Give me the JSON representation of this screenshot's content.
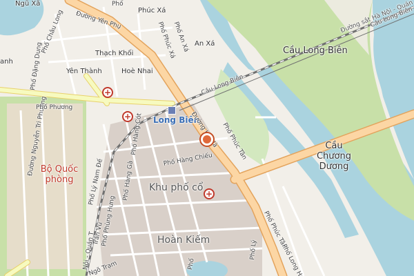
{
  "colors": {
    "land": "#f2efe9",
    "water": "#aad3df",
    "park": "#c8e0a8",
    "military": "#f0dcd5",
    "primary_road": "#fcd6a4",
    "secondary_road": "#f7fabf",
    "minor_road": "#ffffff",
    "railway": "#707070",
    "hospital": "#c0392b",
    "marker": "#e06a3b"
  },
  "icons": {
    "hospital": "hospital-cross-icon",
    "marker": "location-marker-icon",
    "station": "railway-station-icon"
  },
  "labels": {
    "ngu_xa": "Ngũ Xã",
    "duong_yen_phu": "Đường Yên Phụ",
    "phuc_xa": "Phúc Xá",
    "pho_chau_long": "Phố Châu Long",
    "thach_khoi": "Thạch Khối",
    "an_xa": "An Xá",
    "pho_an_xa": "Phố An Xá",
    "pho_phuc_xa": "Phố Phúc Xá",
    "yen_thanh": "Yên Thành",
    "hoe_nhai": "Hoè Nhai",
    "anh": "anh",
    "pho_dang_dung": "Phố Đặng Dung",
    "cau_long_bien_top": "Cầu Long Biên",
    "cau_long_bien_rail": "Cầu Long Biên",
    "rail_label": "Đường sắt Hà Nội - Quán Triều",
    "cau_long_bien_ne": "Cầu Long Biên",
    "long_bien_station": "Long Biên",
    "duong_nguyen_tri_phuong": "Đường Nguyễn Tri Phương",
    "pho_phuong": "Phố Phương",
    "bo_quoc_phong": "Bộ Quốc phòng",
    "cau_chuong_duong": "Cầu Chương Dương",
    "pho_phuc_tan_upper": "Phố Phúc Tân",
    "pho_hang_chieu": "Phố Hàng Chiếu",
    "pho_hang_ga": "Phố Hàng Gà",
    "pho_hang_cot": "Phố Hàng Cót",
    "duong_ho_ha": "Đường Hồ Hà",
    "pho_ly_nam_de": "Phố Lý Nam Đế",
    "pho_phung_hung": "Phố Phùng Hưng",
    "khu_pho_co": "Khu phố cổ",
    "tran_vu": "Trần Vũ",
    "ngo_tram": "Ngõ Trạm",
    "hoan_kiem": "Hoàn Kiếm",
    "pho_phuc_tan_lower": "Phố Phúc Tân",
    "pho_long_hai": "Phố Long Hai",
    "pho_le": "Phố Lê",
    "noi_quan_t": "Nội - Quán T",
    "pho": "Phố",
    "pho_ly": "Phố Lý",
    "pho_top": "Phố"
  }
}
